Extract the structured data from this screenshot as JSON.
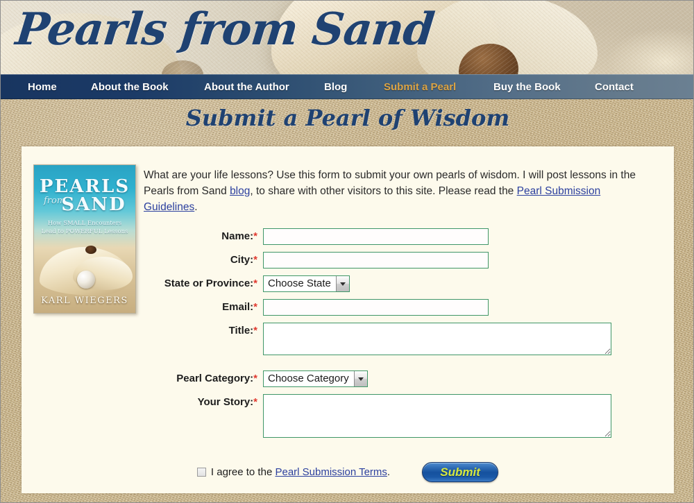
{
  "site": {
    "logo": "Pearls from Sand"
  },
  "nav": {
    "items": [
      {
        "label": "Home",
        "active": false
      },
      {
        "label": "About the Book",
        "active": false
      },
      {
        "label": "About the Author",
        "active": false
      },
      {
        "label": "Blog",
        "active": false
      },
      {
        "label": "Submit a Pearl",
        "active": true
      },
      {
        "label": "Buy the Book",
        "active": false
      },
      {
        "label": "Contact",
        "active": false
      }
    ],
    "active_color": "#dca445",
    "text_color": "#ffffff"
  },
  "page": {
    "title": "Submit a Pearl of Wisdom",
    "title_color": "#1f4272"
  },
  "book_cover": {
    "title_line1": "PEARLS",
    "title_from": "from",
    "title_line2": "SAND",
    "subtitle": "How SMALL Encounters Lead to POWERFUL Lessons",
    "author": "KARL WIEGERS"
  },
  "intro": {
    "part1": "What are your life lessons? Use this form to submit your own pearls of wisdom. I will post lessons in the Pearls from Sand ",
    "link_blog": "blog",
    "part2": ", to share with other visitors to this site. Please read the ",
    "link_guidelines": "Pearl Submission Guidelines",
    "part3": "."
  },
  "form": {
    "fields": {
      "name": {
        "label": "Name:",
        "required": true,
        "value": "",
        "placeholder": ""
      },
      "city": {
        "label": "City:",
        "required": true,
        "value": "",
        "placeholder": ""
      },
      "state": {
        "label": "State or Province:",
        "required": true,
        "value": "Choose State"
      },
      "email": {
        "label": "Email:",
        "required": true,
        "value": "",
        "placeholder": ""
      },
      "title": {
        "label": "Title:",
        "required": true,
        "value": "",
        "placeholder": ""
      },
      "category": {
        "label": "Pearl Category:",
        "required": true,
        "value": "Choose Category"
      },
      "story": {
        "label": "Your Story:",
        "required": true,
        "value": "",
        "placeholder": ""
      }
    },
    "required_marker": "*",
    "border_color": "#3f9667"
  },
  "agree": {
    "checked": false,
    "text_before": "I agree to the ",
    "link": "Pearl Submission Terms",
    "text_after": "."
  },
  "submit": {
    "label": "Submit",
    "text_color": "#d6e840"
  }
}
